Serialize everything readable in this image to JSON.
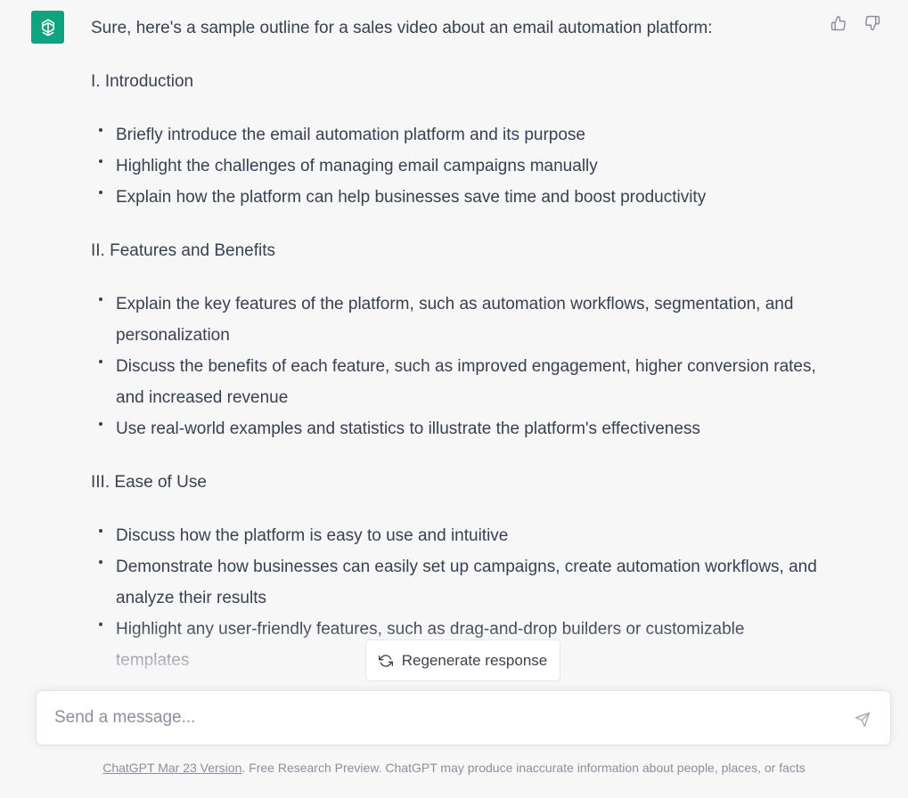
{
  "assistant": {
    "avatar_icon": "openai-logo-icon",
    "avatar_color": "#10a37f"
  },
  "feedback": {
    "thumbs_up_icon": "thumbs-up-icon",
    "thumbs_down_icon": "thumbs-down-icon"
  },
  "message": {
    "intro": "Sure, here's a sample outline for a sales video about an email automation platform:",
    "sections": [
      {
        "heading": "I. Introduction",
        "bullets": [
          "Briefly introduce the email automation platform and its purpose",
          "Highlight the challenges of managing email campaigns manually",
          "Explain how the platform can help businesses save time and boost productivity"
        ]
      },
      {
        "heading": "II. Features and Benefits",
        "bullets": [
          "Explain the key features of the platform, such as automation workflows, segmentation, and personalization",
          "Discuss the benefits of each feature, such as improved engagement, higher conversion rates, and increased revenue",
          "Use real-world examples and statistics to illustrate the platform's effectiveness"
        ]
      },
      {
        "heading": "III. Ease of Use",
        "bullets": [
          "Discuss how the platform is easy to use and intuitive",
          "Demonstrate how businesses can easily set up campaigns, create automation workflows, and analyze their results",
          "Highlight any user-friendly features, such as drag-and-drop builders or customizable templates"
        ]
      }
    ]
  },
  "regenerate": {
    "label": "Regenerate response",
    "icon": "refresh-icon"
  },
  "composer": {
    "placeholder": "Send a message...",
    "value": "",
    "send_icon": "send-icon"
  },
  "footer": {
    "version_link": "ChatGPT Mar 23 Version",
    "disclaimer": ". Free Research Preview. ChatGPT may produce inaccurate information about people, places, or facts"
  }
}
